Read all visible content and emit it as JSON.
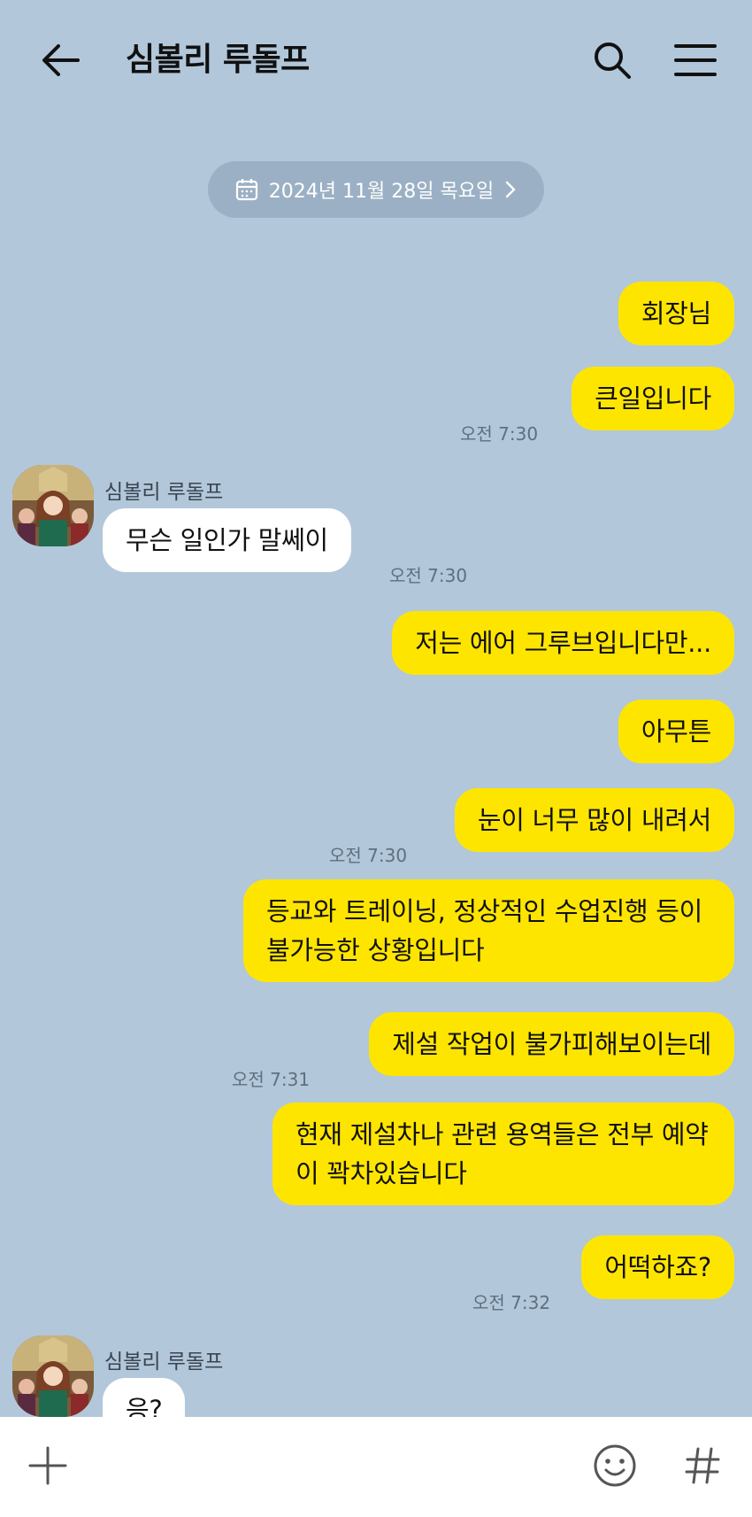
{
  "header": {
    "title": "심볼리 루돌프",
    "back_icon": "back-arrow-icon",
    "search_icon": "search-icon",
    "menu_icon": "hamburger-menu-icon"
  },
  "date_divider": {
    "text": "2024년 11월 28일 목요일",
    "icon": "calendar-icon",
    "chevron": "chevron-right-icon"
  },
  "messages": [
    {
      "from": "me",
      "text": "회장님"
    },
    {
      "from": "me",
      "text": "큰일입니다",
      "time": "오전 7:30"
    },
    {
      "from": "them",
      "sender": "심볼리 루돌프",
      "text": "무슨 일인가 말쎄이",
      "time": "오전 7:30"
    },
    {
      "from": "me",
      "text": "저는 에어 그루브입니다만..."
    },
    {
      "from": "me",
      "text": "아무튼"
    },
    {
      "from": "me",
      "text": "눈이 너무 많이 내려서",
      "time": "오전 7:30"
    },
    {
      "from": "me",
      "text": "등교와 트레이닝, 정상적인 수업진행 등이 불가능한 상황입니다"
    },
    {
      "from": "me",
      "text": "제설 작업이 불가피해보이는데",
      "time": "오전 7:31"
    },
    {
      "from": "me",
      "text": "현재 제설차나 관련 용역들은 전부 예약이 꽉차있습니다"
    },
    {
      "from": "me",
      "text": "어떡하죠?",
      "time": "오전 7:32"
    },
    {
      "from": "them",
      "sender": "심볼리 루돌프",
      "text": "응?"
    }
  ],
  "input_bar": {
    "plus_icon": "plus-icon",
    "emoji_icon": "emoji-icon",
    "hash_icon": "hash-icon"
  },
  "colors": {
    "background": "#b2c7da",
    "my_bubble": "#fee500",
    "their_bubble": "#ffffff",
    "date_pill": "#9bb0c4"
  }
}
